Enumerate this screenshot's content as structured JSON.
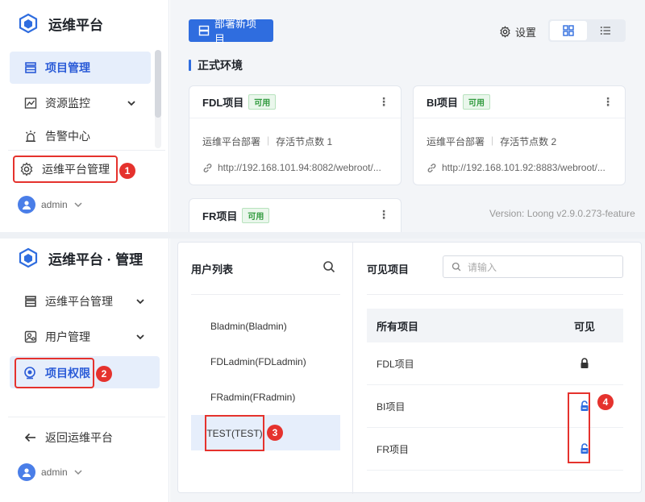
{
  "top": {
    "brand": "运维平台",
    "nav": {
      "project_mgmt": "项目管理",
      "resource_monitor": "资源监控",
      "alerts": "告警中心",
      "platform_mgmt": "运维平台管理"
    },
    "user": "admin",
    "deploy_button": "部署新项目",
    "settings": "设置",
    "section": "正式环境",
    "cards": [
      {
        "name": "FDL项目",
        "status": "可用",
        "desc": "运维平台部署",
        "nodes": "存活节点数 1",
        "url": "http://192.168.101.94:8082/webroot/..."
      },
      {
        "name": "BI项目",
        "status": "可用",
        "desc": "运维平台部署",
        "nodes": "存活节点数 2",
        "url": "http://192.168.101.92:8883/webroot/..."
      },
      {
        "name": "FR项目",
        "status": "可用"
      }
    ],
    "version": "Version: Loong v2.9.0.273-feature"
  },
  "bottom": {
    "brand": "运维平台 · 管理",
    "nav": {
      "platform_mgmt": "运维平台管理",
      "user_mgmt": "用户管理",
      "project_perm": "项目权限",
      "back": "返回运维平台"
    },
    "user": "admin",
    "user_list_title": "用户列表",
    "users": [
      "Bladmin(Bladmin)",
      "FDLadmin(FDLadmin)",
      "FRadmin(FRadmin)",
      "TEST(TEST)"
    ],
    "visible_title": "可见项目",
    "search_placeholder": "请输入",
    "table": {
      "col_all": "所有项目",
      "col_visible": "可见",
      "rows": [
        {
          "name": "FDL项目",
          "visible": "locked"
        },
        {
          "name": "BI项目",
          "visible": "unlocked"
        },
        {
          "name": "FR项目",
          "visible": "unlocked"
        }
      ]
    }
  },
  "markers": [
    "1",
    "2",
    "3",
    "4"
  ],
  "colors": {
    "accent": "#2f6ddf",
    "marker": "#e5322d",
    "available": "#2f9a3d"
  }
}
